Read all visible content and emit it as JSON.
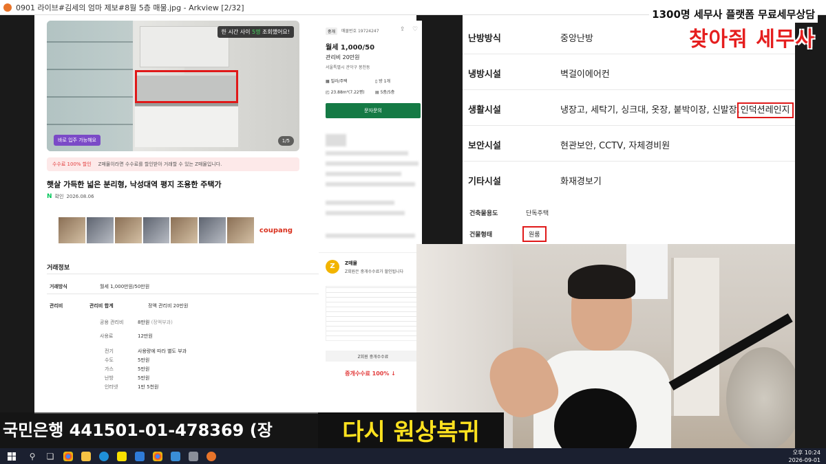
{
  "window": {
    "title": "0901 라이브#김세의 엄마 제보#8월 5층 매물.jpg - Arkview [2/32]"
  },
  "brand": {
    "tagline": "1300명 세무사 플랫폼 무료세무상담",
    "name": "찾아줘 세무사",
    "accent_color": "#e51e1e"
  },
  "listing": {
    "photo": {
      "view_badge_prefix": "한 시간 사이",
      "view_badge_count": "5명",
      "view_badge_suffix": "조회했어요!",
      "move_in_badge": "바로 입주 가능해요",
      "counter": "1/5"
    },
    "fee_banner": {
      "highlight": "수수료 100% 할인",
      "text": "Z매물이라면 수수료를 할인받아 거래할 수 있는 Z매물입니다."
    },
    "title": "햇살 가득한 넓은 분리형, 낙성대역 평지 조용한 주택가",
    "verified_label": "확인",
    "verified_date": "2026.08.06",
    "ad_brand": "coupang",
    "deal": {
      "heading": "거래정보",
      "rows": [
        {
          "key": "거래방식",
          "value": "월세 1,000만원/50만원"
        },
        {
          "key": "관리비",
          "sub_key": "관리비 합계",
          "value": "정액 관리비 20만원"
        }
      ],
      "breakdown": [
        {
          "label": "공용 관리비",
          "value": "8만원",
          "note": "(정액부과)"
        },
        {
          "label": "사용료",
          "value": "12만원"
        }
      ],
      "usage_items": [
        {
          "label": "전기",
          "value": "사용량에 따라 별도 부과"
        },
        {
          "label": "수도",
          "value": "5만원"
        },
        {
          "label": "가스",
          "value": "5만원"
        },
        {
          "label": "난방",
          "value": "5만원"
        },
        {
          "label": "인터넷",
          "value": "1만 5천원"
        }
      ]
    }
  },
  "agent": {
    "tag": "중개",
    "reg_no": "매물번호 19724247",
    "price": "월세 1,000/50",
    "management": "관리비 20만원",
    "address": "서울특별시 관악구 봉천동",
    "specs": [
      {
        "icon": "building-icon",
        "text": "빌라/주택"
      },
      {
        "icon": "door-icon",
        "text": "방 1개"
      },
      {
        "icon": "area-icon",
        "text": "23.88m²(7.22평)"
      },
      {
        "icon": "floor-icon",
        "text": "5층/5층"
      }
    ],
    "inquiry_button": "문자문의"
  },
  "z_panel": {
    "logo": "Z",
    "name": "Z매물",
    "desc": "Z회원은 중개수수료가 할인됩니다",
    "bar": "Z회원 중개수수료",
    "free_label": "중개수수료 100% ↓"
  },
  "amenity": {
    "rows": [
      {
        "key": "난방방식",
        "value": "중앙난방"
      },
      {
        "key": "냉방시설",
        "value": "벽걸이에어컨"
      },
      {
        "key": "생활시설",
        "value": "냉장고, 세탁기, 싱크대, 옷장, 붙박이장, 신발장,",
        "marked": "인덕션레인지"
      },
      {
        "key": "보안시설",
        "value": "현관보안, CCTV, 자체경비원"
      },
      {
        "key": "기타시설",
        "value": "화재경보기"
      }
    ],
    "building": [
      {
        "key": "건축물용도",
        "value": "단독주택"
      },
      {
        "key": "건물형태",
        "value": "원룸"
      }
    ]
  },
  "captions": {
    "bank": "국민은행 441501-01-478369 (장",
    "main": "다시 원상복귀"
  },
  "taskbar": {
    "time": "오후 10:24",
    "date": "2026-09-01"
  }
}
